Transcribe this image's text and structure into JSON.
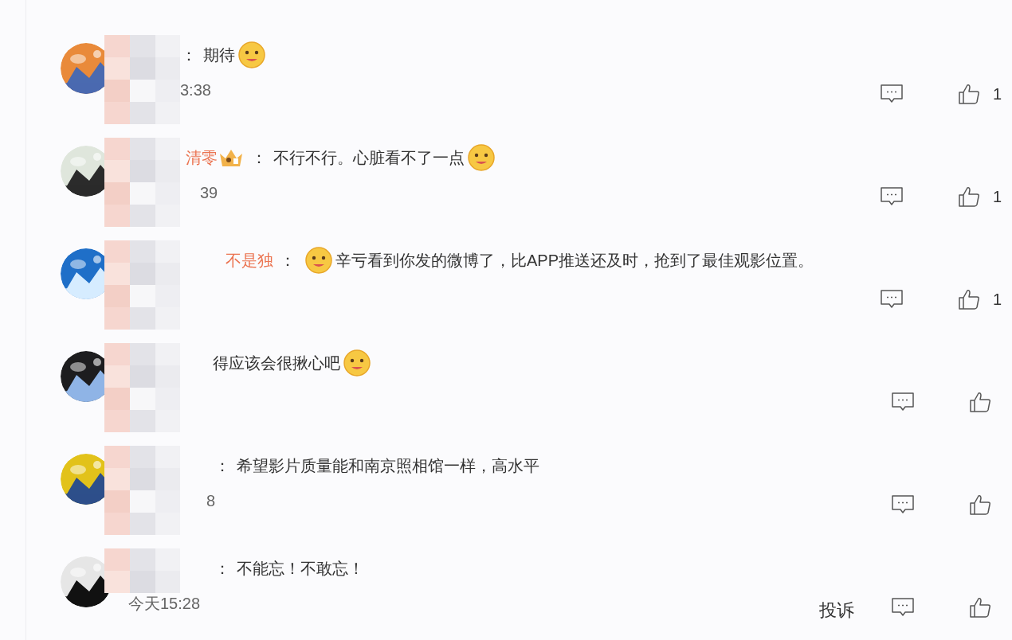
{
  "comments": [
    {
      "colon": "：",
      "parts": [
        {
          "kind": "text",
          "text": "期待"
        },
        {
          "kind": "emoji"
        }
      ],
      "time": "3:38",
      "likes": "1"
    },
    {
      "name_suffix": "清零",
      "badge": true,
      "colon": "：",
      "parts": [
        {
          "kind": "text",
          "text": "不行不行。心脏看不了一点"
        },
        {
          "kind": "emoji"
        }
      ],
      "time": "39",
      "likes": "1"
    },
    {
      "name_suffix": "不是独",
      "colon": "：",
      "parts": [
        {
          "kind": "emoji"
        },
        {
          "kind": "text",
          "text": "辛亏看到你发的微博了，比APP推送还及时，抢到了最佳观影位置。"
        }
      ],
      "likes": "1"
    },
    {
      "parts": [
        {
          "kind": "text",
          "text": "得应该会很揪心吧"
        },
        {
          "kind": "emoji"
        }
      ]
    },
    {
      "colon": "：",
      "parts": [
        {
          "kind": "text",
          "text": "希望影片质量能和南京照相馆一样，高水平"
        }
      ],
      "time": "8"
    },
    {
      "colon": "：",
      "parts": [
        {
          "kind": "text",
          "text": "不能忘！不敢忘！"
        }
      ],
      "time": "今天15:28",
      "report": "投诉"
    }
  ]
}
